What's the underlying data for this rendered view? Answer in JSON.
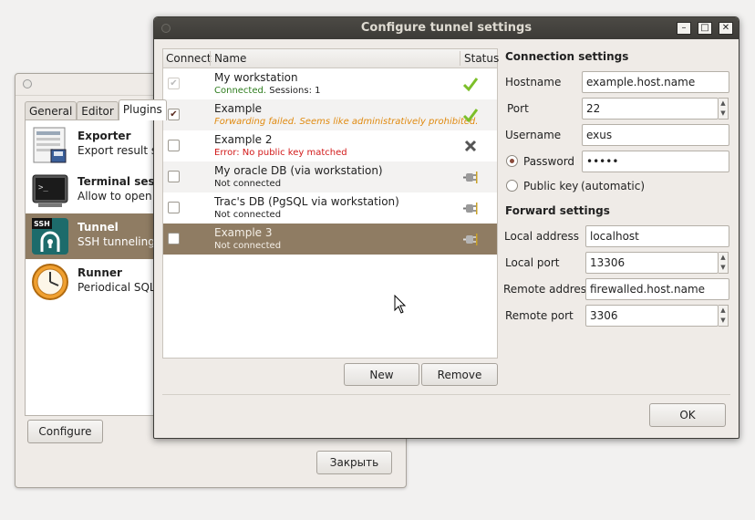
{
  "background_window": {
    "tabs": [
      "General",
      "Editor",
      "Plugins"
    ],
    "plugins": [
      {
        "title": "Exporter",
        "desc": "Export result se",
        "icon": "exporter-icon"
      },
      {
        "title": "Terminal sessi",
        "desc": "Allow to open te",
        "icon": "terminal-icon"
      },
      {
        "title": "Tunnel",
        "desc": "SSH tunneling",
        "icon": "ssh-tunnel-icon"
      },
      {
        "title": "Runner",
        "desc": "Periodical SQL e",
        "icon": "clock-icon"
      }
    ],
    "ssh_badge": "SSH",
    "configure_button": "Configure",
    "close_button": "Закрыть"
  },
  "dialog": {
    "title": "Configure tunnel settings",
    "window_buttons": {
      "minimize": "–",
      "maximize": "□",
      "close": "✕"
    },
    "list": {
      "columns": [
        "Connect",
        "Name",
        "Status"
      ],
      "rows": [
        {
          "name": "My workstation",
          "status_text": "Connected.",
          "sessions": "Sessions: 1",
          "checked": true,
          "status": "connected"
        },
        {
          "name": "Example",
          "status_text": "Forwarding failed. Seems like administratively prohibited.",
          "checked": true,
          "status": "connected"
        },
        {
          "name": "Example 2",
          "status_text": "Error: No public key matched",
          "checked": false,
          "status": "error"
        },
        {
          "name": "My oracle DB (via workstation)",
          "status_text": "Not connected",
          "checked": false,
          "status": "disconnected"
        },
        {
          "name": "Trac's DB (PgSQL via workstation)",
          "status_text": "Not connected",
          "checked": false,
          "status": "disconnected"
        },
        {
          "name": "Example 3",
          "status_text": "Not connected",
          "checked": false,
          "status": "disconnected"
        }
      ]
    },
    "new_button": "New",
    "remove_button": "Remove",
    "connection_settings": {
      "heading": "Connection settings",
      "hostname_label": "Hostname",
      "hostname": "example.host.name",
      "port_label": "Port",
      "port": "22",
      "username_label": "Username",
      "username": "exus",
      "password_label": "Password",
      "password": "•••••",
      "publickey_label": "Public key",
      "publickey_note": "(automatic)"
    },
    "forward_settings": {
      "heading": "Forward settings",
      "local_address_label": "Local address",
      "local_address": "localhost",
      "local_port_label": "Local port",
      "local_port": "13306",
      "remote_address_label": "Remote address",
      "remote_address": "firewalled.host.name",
      "remote_port_label": "Remote port",
      "remote_port": "3306"
    },
    "ok_button": "OK"
  }
}
